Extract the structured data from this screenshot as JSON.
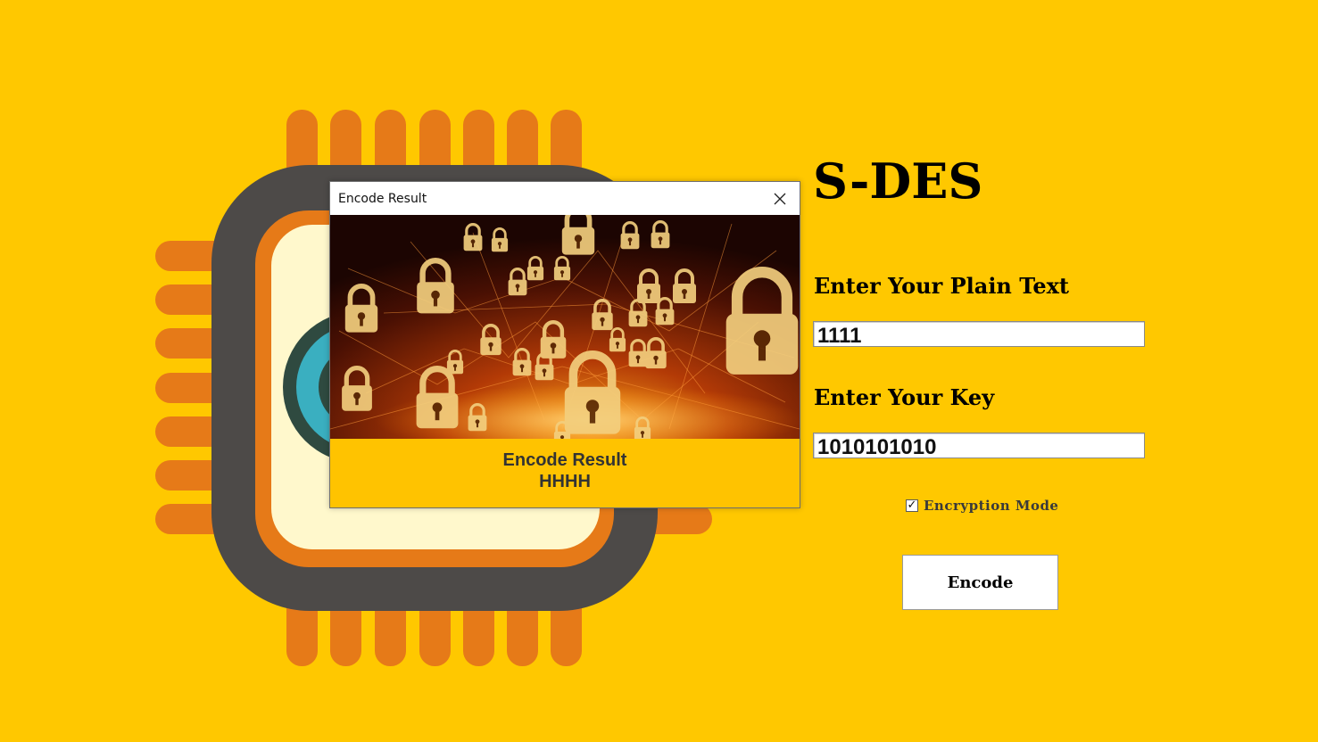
{
  "app": {
    "title": "S-DES"
  },
  "form": {
    "plain_text_label": "Enter Your Plain Text",
    "plain_text_value": "1111",
    "key_label": "Enter Your Key",
    "key_value": "1010101010",
    "mode_checkbox": {
      "label": "Encryption Mode",
      "checked": true
    },
    "encode_button_label": "Encode"
  },
  "dialog": {
    "title": "Encode Result",
    "result_label": "Encode Result",
    "result_value": "HHHH",
    "image_icon": "padlock-network-icon"
  },
  "colors": {
    "background": "#FFC800",
    "chip_body": "#4D4A48",
    "chip_pins": "#E67A18",
    "chip_inner": "#FFF8CC",
    "chip_lens": "#3AAFC0",
    "dialog_footer": "#FFC300"
  }
}
